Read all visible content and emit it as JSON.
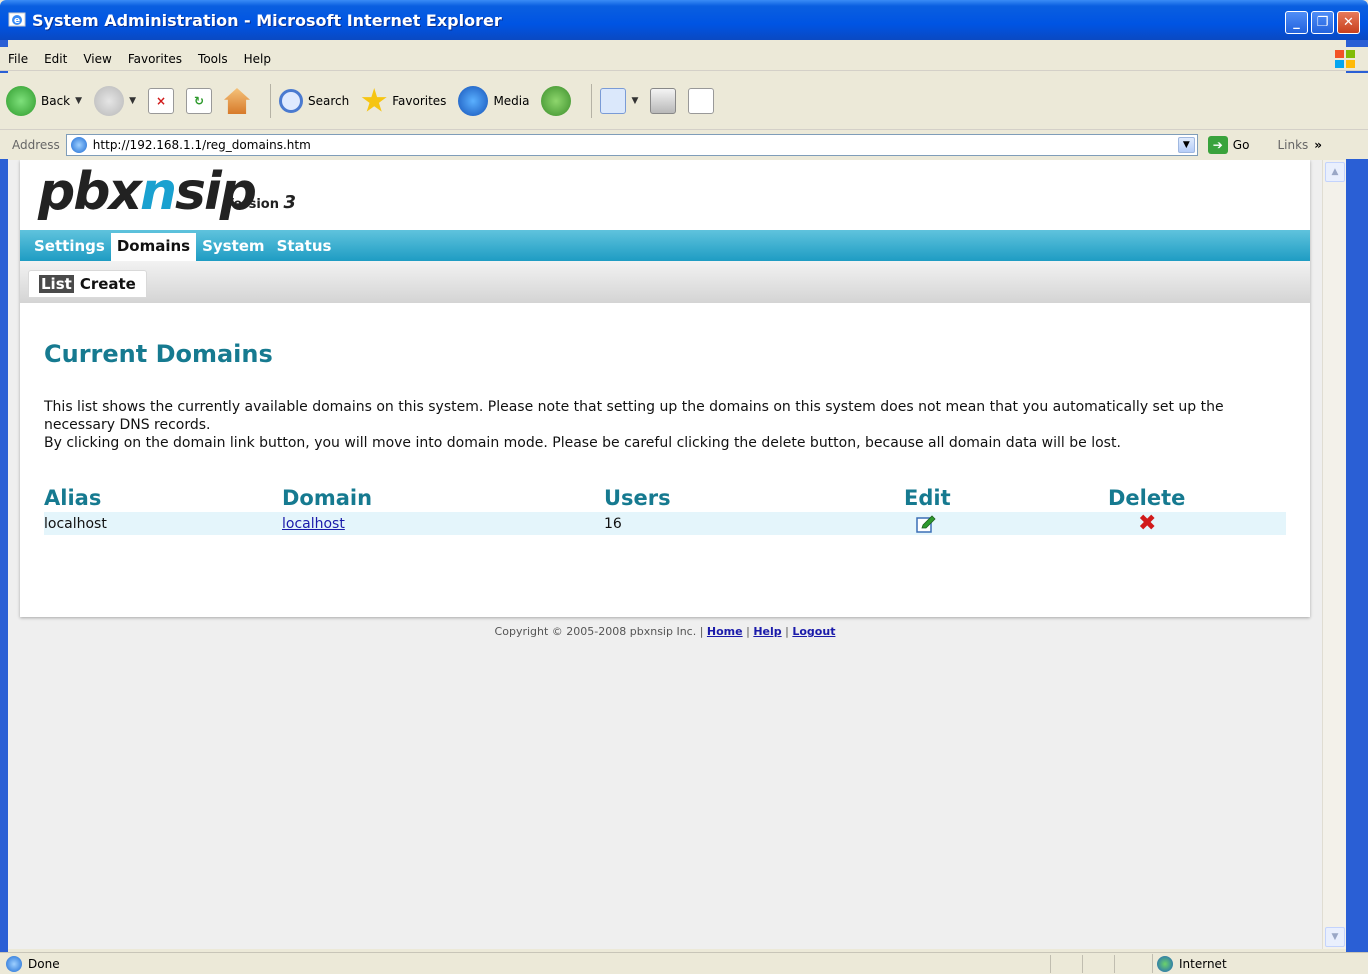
{
  "window": {
    "title": "System Administration - Microsoft Internet Explorer",
    "minimize": "_",
    "maximize": "❐",
    "close": "✕"
  },
  "menu": [
    "File",
    "Edit",
    "View",
    "Favorites",
    "Tools",
    "Help"
  ],
  "toolbar": {
    "back": "Back",
    "search": "Search",
    "favorites": "Favorites",
    "media": "Media"
  },
  "address": {
    "label": "Address",
    "url": "http://192.168.1.1/reg_domains.htm",
    "go": "Go",
    "links": "Links"
  },
  "logo": {
    "text_a": "pbx",
    "text_b": "n",
    "text_c": "sip",
    "version_label": "Version",
    "version_num": "3"
  },
  "nav": {
    "tabs": [
      "Settings",
      "Domains",
      "System",
      "Status"
    ],
    "active": "Domains"
  },
  "subnav": {
    "tabs": [
      "List",
      "Create"
    ],
    "active": "List"
  },
  "main": {
    "heading": "Current Domains",
    "desc1": "This list shows the currently available domains on this system. Please note that setting up the domains on this system does not mean that you automatically set up the necessary DNS records.",
    "desc2": "By clicking on the domain link button, you will move into domain mode. Please be careful clicking the delete button, because all domain data will be lost.",
    "columns": [
      "Alias",
      "Domain",
      "Users",
      "Edit",
      "Delete"
    ],
    "rows": [
      {
        "alias": "localhost",
        "domain": "localhost",
        "users": "16"
      }
    ]
  },
  "footer": {
    "copyright": "Copyright © 2005-2008 pbxnsip Inc. |",
    "home": "Home",
    "help": "Help",
    "logout": "Logout",
    "sep": "|"
  },
  "status": {
    "text": "Done",
    "zone": "Internet"
  },
  "colors": {
    "accent": "#167a90",
    "nav_bar": "#1e9cc3",
    "row_bg": "#e4f5fb",
    "delete": "#d11a1a"
  }
}
